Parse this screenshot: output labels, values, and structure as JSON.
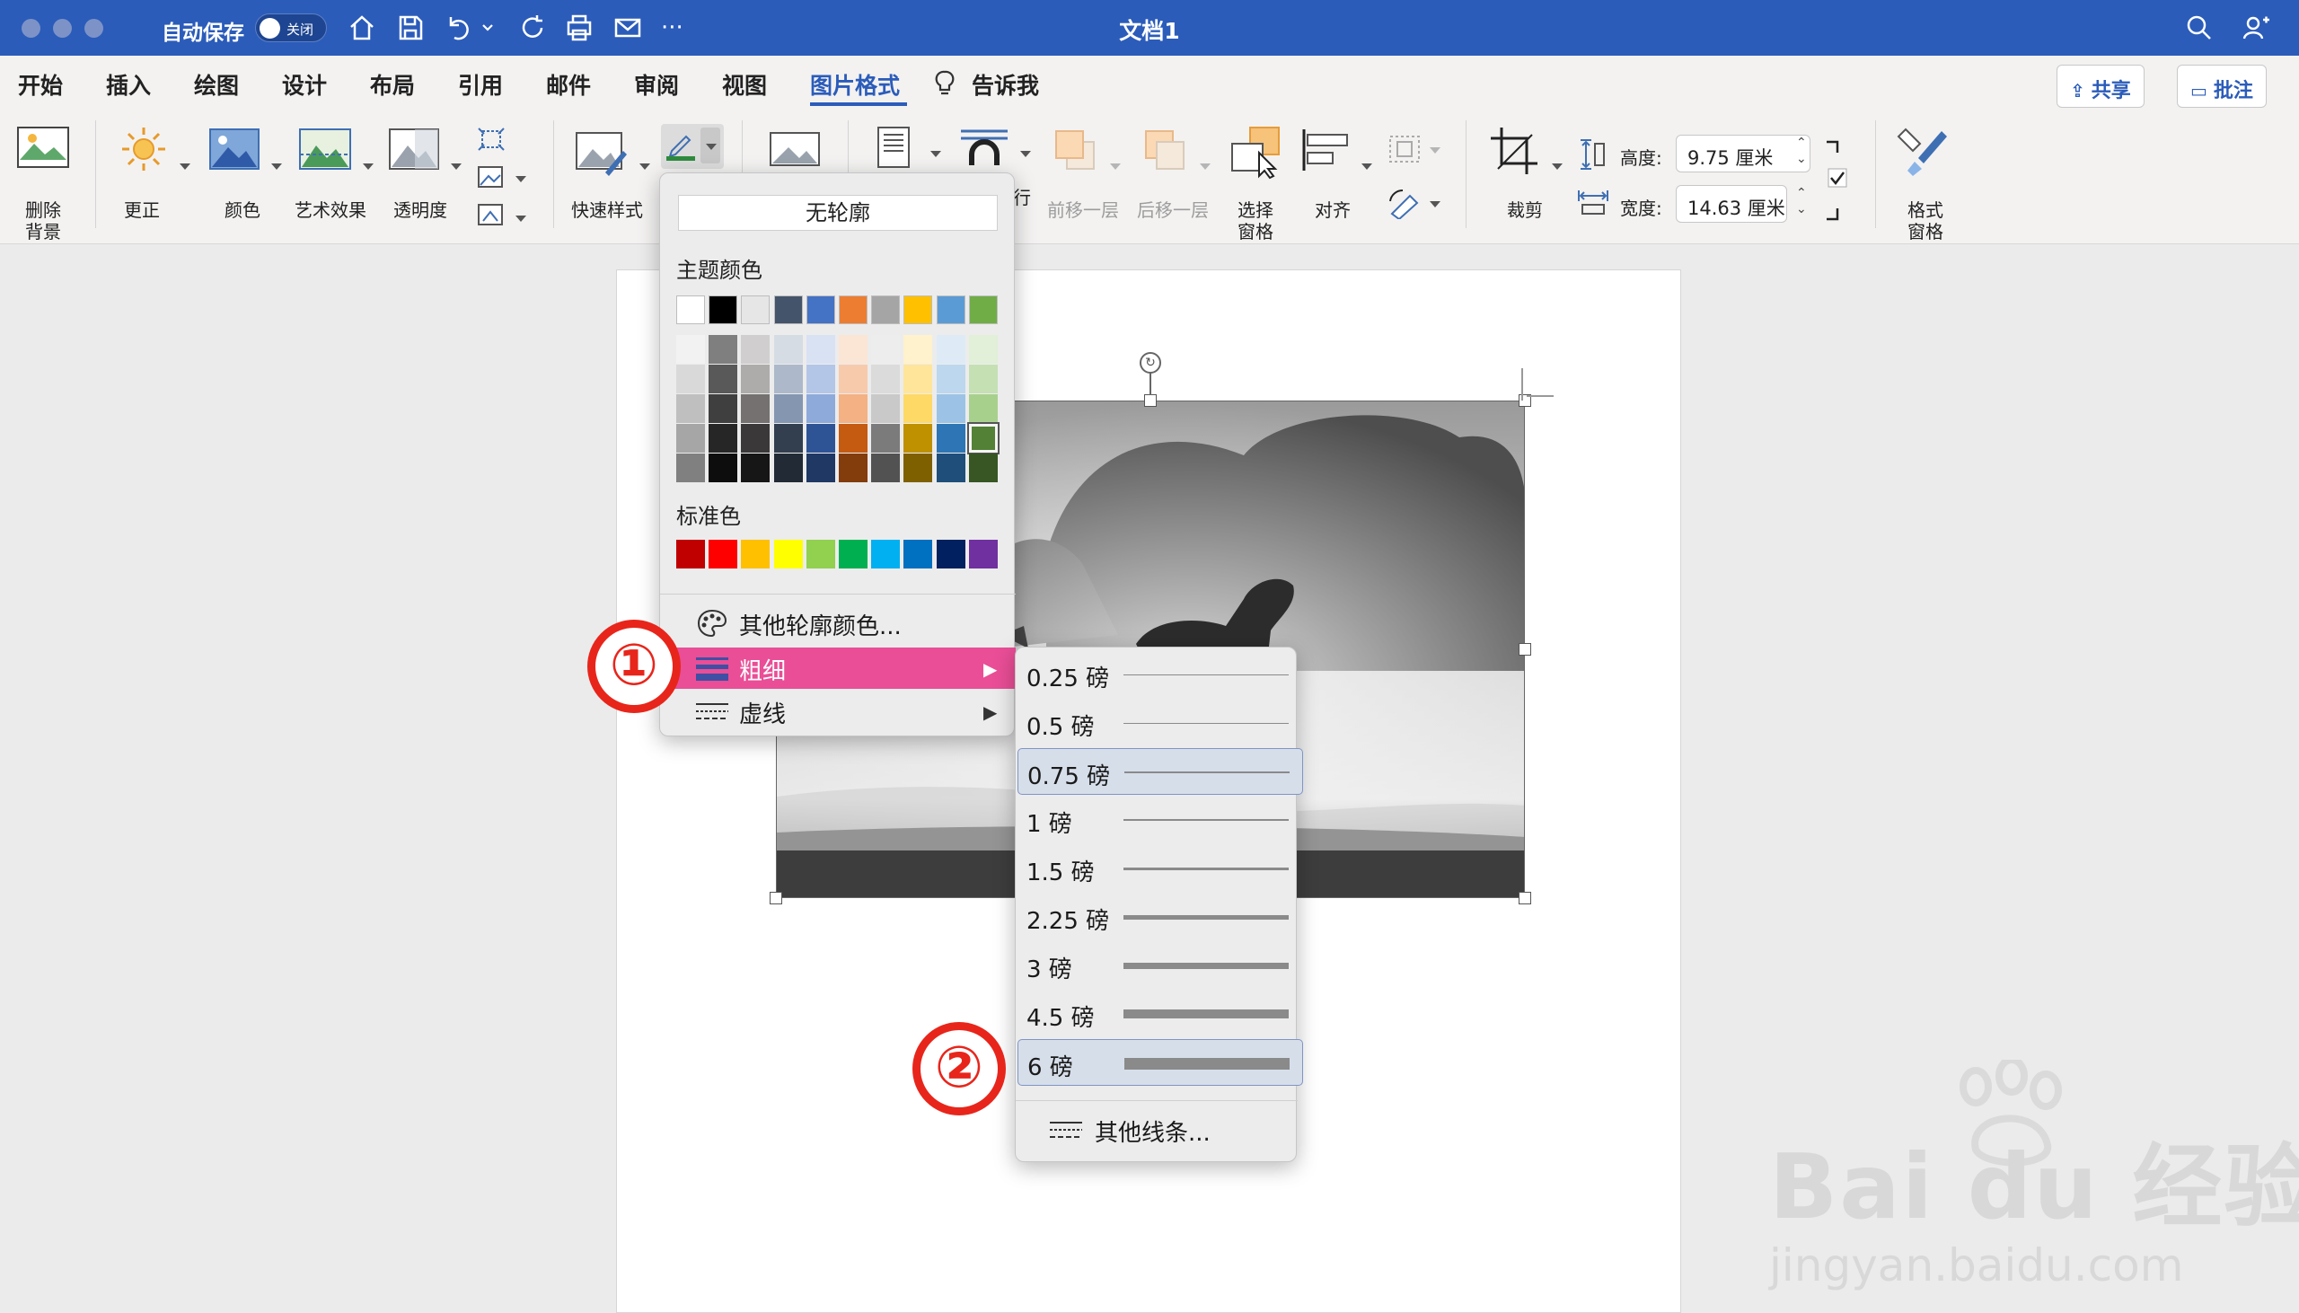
{
  "titlebar": {
    "autosave_label": "自动保存",
    "autosave_toggle": "关闭",
    "doc_title": "文档1"
  },
  "tabs": [
    "开始",
    "插入",
    "绘图",
    "设计",
    "布局",
    "引用",
    "邮件",
    "审阅",
    "视图",
    "图片格式",
    "告诉我"
  ],
  "active_tab": "图片格式",
  "share_label": "共享",
  "comment_label": "批注",
  "ribbon": {
    "remove_bg": "删除\n背景",
    "correct": "更正",
    "color": "颜色",
    "art_effects": "艺术效果",
    "transparency": "透明度",
    "quick_styles": "快速样式",
    "wrap_partial": "行",
    "bring_forward": "前移一层",
    "send_backward": "后移一层",
    "selection_pane": "选择\n窗格",
    "align": "对齐",
    "crop": "裁剪",
    "height_label": "高度:",
    "height_value": "9.75 厘米",
    "width_label": "宽度:",
    "width_value": "14.63 厘米",
    "format_pane": "格式\n窗格"
  },
  "outline_menu": {
    "no_outline": "无轮廓",
    "theme_colors_title": "主题颜色",
    "theme_top": [
      "#ffffff",
      "#000000",
      "#e7e6e6",
      "#44546a",
      "#4472c4",
      "#ed7d31",
      "#a5a5a5",
      "#ffc000",
      "#5b9bd5",
      "#70ad47"
    ],
    "theme_shades": [
      [
        "#f2f2f2",
        "#d9d9d9",
        "#bfbfbf",
        "#a6a6a6",
        "#808080"
      ],
      [
        "#7f7f7f",
        "#595959",
        "#3f3f3f",
        "#262626",
        "#0d0d0d"
      ],
      [
        "#d0cece",
        "#aeabab",
        "#757171",
        "#3a3838",
        "#171616"
      ],
      [
        "#d6dce4",
        "#adb9ca",
        "#8496b0",
        "#333f4f",
        "#222a35"
      ],
      [
        "#d9e2f3",
        "#b4c6e7",
        "#8eaadb",
        "#2f5496",
        "#1f3864"
      ],
      [
        "#fbe5d5",
        "#f7caac",
        "#f4b183",
        "#c55a11",
        "#833c0b"
      ],
      [
        "#ededed",
        "#dbdbdb",
        "#c9c9c9",
        "#7b7b7b",
        "#525252"
      ],
      [
        "#fff2cc",
        "#ffe599",
        "#ffd966",
        "#bf9000",
        "#7f6000"
      ],
      [
        "#deebf6",
        "#bdd7ee",
        "#9cc3e5",
        "#2e75b5",
        "#1e4e79"
      ],
      [
        "#e2efd9",
        "#c5e0b3",
        "#a8d08d",
        "#538135",
        "#375623"
      ]
    ],
    "standard_title": "标准色",
    "standard_colors": [
      "#c00000",
      "#ff0000",
      "#ffc000",
      "#ffff00",
      "#92d050",
      "#00b050",
      "#00b0f0",
      "#0070c0",
      "#002060",
      "#7030a0"
    ],
    "more_colors": "其他轮廓颜色...",
    "weight": "粗细",
    "dashes": "虚线"
  },
  "weight_menu": {
    "items": [
      {
        "label": "0.25 磅",
        "pt": 0.25
      },
      {
        "label": "0.5 磅",
        "pt": 0.5
      },
      {
        "label": "0.75 磅",
        "pt": 0.75
      },
      {
        "label": "1 磅",
        "pt": 1
      },
      {
        "label": "1.5 磅",
        "pt": 1.5
      },
      {
        "label": "2.25 磅",
        "pt": 2.25
      },
      {
        "label": "3 磅",
        "pt": 3
      },
      {
        "label": "4.5 磅",
        "pt": 4.5
      },
      {
        "label": "6 磅",
        "pt": 6
      }
    ],
    "selected": [
      "0.75 磅",
      "6 磅"
    ],
    "more_lines": "其他线条..."
  },
  "annotations": {
    "step1": "①",
    "step2": "②"
  },
  "watermark": {
    "brand": "Bai du 经验",
    "url": "jingyan.baidu.com"
  },
  "colors": {
    "titlebar": "#2b5cba",
    "accent": "#2b5cba",
    "highlight": "#e94e96",
    "badge": "#e8251b"
  }
}
